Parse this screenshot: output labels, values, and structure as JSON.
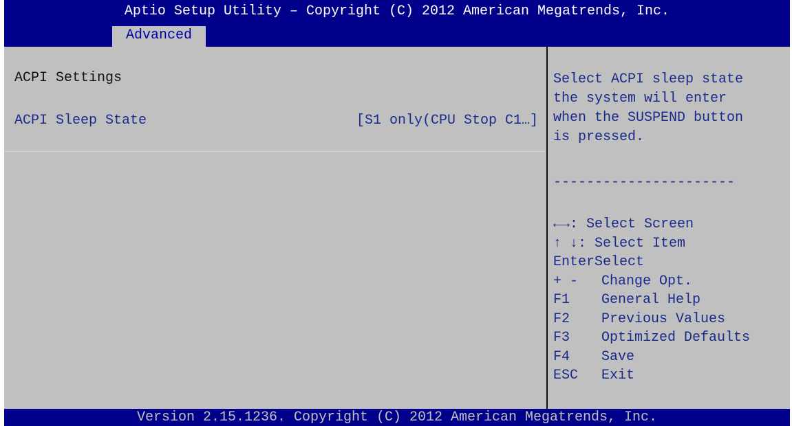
{
  "header": {
    "title": "Aptio Setup Utility – Copyright (C) 2012 American Megatrends, Inc."
  },
  "tabs": [
    {
      "label": "Advanced",
      "selected": true
    }
  ],
  "main": {
    "section_title": "ACPI Settings",
    "settings": [
      {
        "label": "ACPI Sleep State",
        "value": "[S1 only(CPU Stop C1…]"
      }
    ]
  },
  "help": {
    "text": "Select ACPI sleep state\nthe system will enter\nwhen the SUSPEND button\nis pressed.",
    "separator": "----------------------",
    "keys": [
      {
        "key": "←→:",
        "action": "Select Screen"
      },
      {
        "key": "↑ ↓:",
        "action": "Select Item"
      },
      {
        "key": "Enter",
        "action": "Select"
      },
      {
        "key": "+ -",
        "action": "Change Opt."
      },
      {
        "key": "F1",
        "action": "General Help"
      },
      {
        "key": "F2",
        "action": "Previous Values"
      },
      {
        "key": "F3",
        "action": "Optimized Defaults"
      },
      {
        "key": "F4",
        "action": "Save"
      },
      {
        "key": "ESC",
        "action": "Exit"
      }
    ]
  },
  "footer": {
    "text": "Version 2.15.1236. Copyright (C) 2012 American Megatrends, Inc."
  },
  "colors": {
    "bar_blue": "#00008b",
    "panel_gray": "#c0c0c0",
    "text_blue": "#1a2a8a",
    "text_dark": "#101010"
  }
}
